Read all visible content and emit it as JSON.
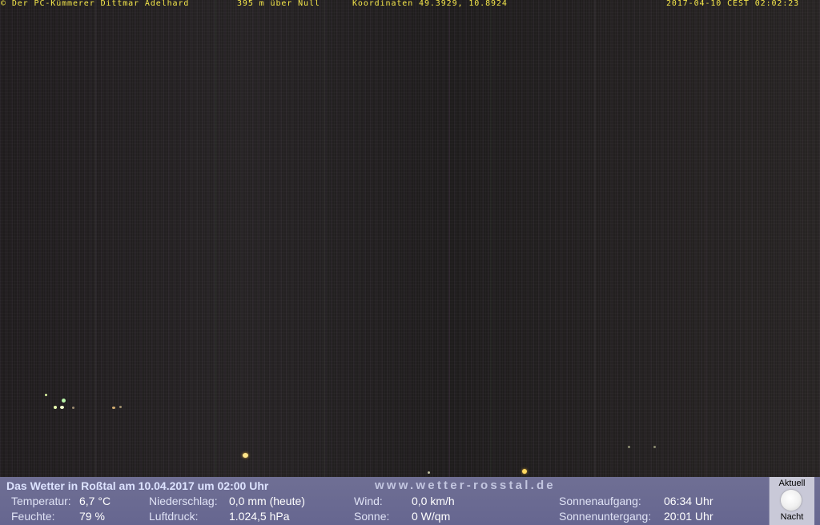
{
  "header": {
    "copyright": "© Der PC-Kümmerer Dittmar Adelhard",
    "altitude": "395 m über Null",
    "coordinates": "Koordinaten 49.3929, 10.8924",
    "timestamp": "2017-04-10 CEST 02:02:23"
  },
  "weather": {
    "title": "Das Wetter in Roßtal am 10.04.2017 um 02:00 Uhr",
    "url": "www.wetter-rosstal.de",
    "temperature_label": "Temperatur:",
    "temperature_value": "6,7 °C",
    "humidity_label": "Feuchte:",
    "humidity_value": "79 %",
    "precip_label": "Niederschlag:",
    "precip_value": "0,0 mm (heute)",
    "pressure_label": "Luftdruck:",
    "pressure_value": "1.024,5 hPa",
    "wind_label": "Wind:",
    "wind_value": "0,0 km/h",
    "sun_label": "Sonne:",
    "sun_value": "0 W/qm",
    "sunrise_label": "Sonnenaufgang:",
    "sunrise_value": "06:34 Uhr",
    "sunset_label": "Sonnenuntergang:",
    "sunset_value": "20:01 Uhr"
  },
  "moon": {
    "top_label": "Aktuell",
    "bottom_label": "Nacht",
    "icon": "full-moon-icon"
  }
}
